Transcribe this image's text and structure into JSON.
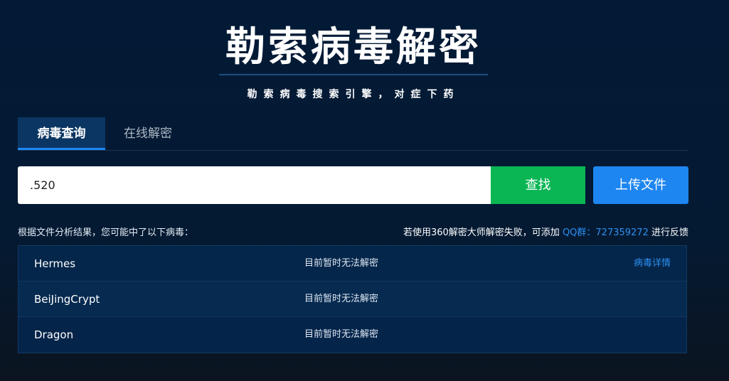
{
  "header": {
    "title": "勒索病毒解密",
    "subtitle": "勒索病毒搜索引擎，对症下药"
  },
  "tabs": [
    {
      "label": "病毒查询"
    },
    {
      "label": "在线解密"
    }
  ],
  "search": {
    "value": ".520",
    "find_label": "查找",
    "upload_label": "上传文件"
  },
  "notes": {
    "left": "根据文件分析结果，您可能中了以下病毒：",
    "right_prefix": "若使用360解密大师解密失败，可添加",
    "qq": "QQ群：727359272",
    "right_suffix": "进行反馈"
  },
  "results": [
    {
      "name": "Hermes",
      "status": "目前暂时无法解密",
      "link": "病毒详情"
    },
    {
      "name": "BeiJingCrypt",
      "status": "目前暂时无法解密"
    },
    {
      "name": "Dragon",
      "status": "目前暂时无法解密"
    }
  ]
}
